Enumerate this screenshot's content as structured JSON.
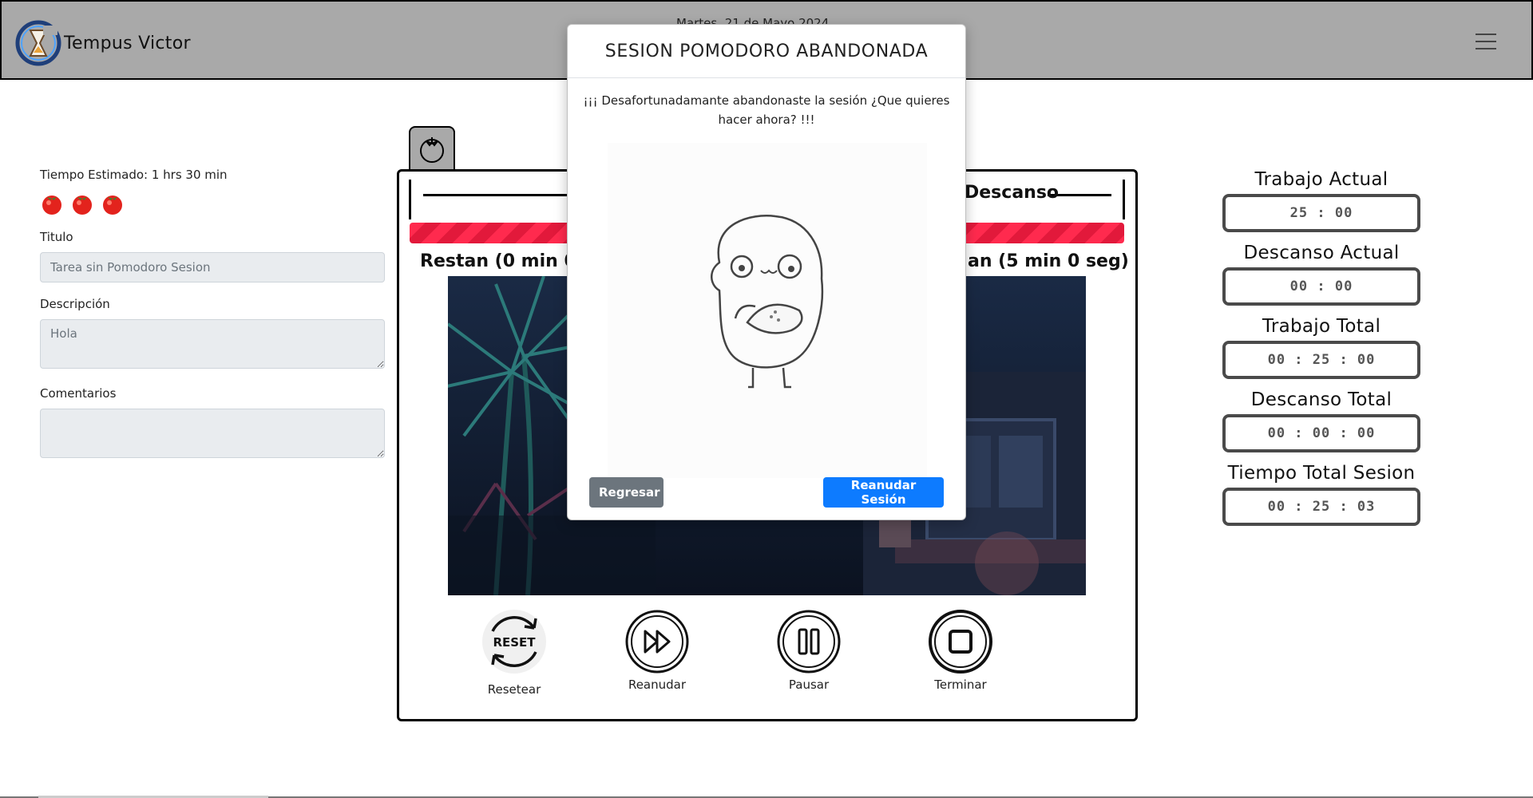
{
  "navbar": {
    "brand": "Tempus Victor",
    "date": "Martes, 21 de Mayo 2024"
  },
  "left": {
    "estimated": "Tiempo Estimado: 1 hrs 30 min",
    "tomato_count": 3,
    "title_label": "Titulo",
    "title_value": "Tarea sin Pomodoro Sesion",
    "description_label": "Descripción",
    "description_value": "Hola",
    "comments_label": "Comentarios",
    "comments_value": ""
  },
  "timer": {
    "phase_right": "Descanso",
    "remaining_left": "Restan (0 min 0",
    "remaining_right": "an (5 min 0 seg)",
    "progress_percent": 100,
    "controls": [
      "Resetear",
      "Reanudar",
      "Pausar",
      "Terminar"
    ],
    "reset_text": "RESET"
  },
  "stats": [
    {
      "label": "Trabajo Actual",
      "value": "25 : 00"
    },
    {
      "label": "Descanso Actual",
      "value": "00 : 00"
    },
    {
      "label": "Trabajo Total",
      "value": "00 : 25 : 00"
    },
    {
      "label": "Descanso Total",
      "value": "00 : 00 : 00"
    },
    {
      "label": "Tiempo Total Sesion",
      "value": "00 : 25 : 03"
    }
  ],
  "modal": {
    "title": "SESION POMODORO ABANDONADA",
    "message": "¡¡¡ Desafortunadamante abandonaste la sesión ¿Que quieres hacer ahora? !!!",
    "back_button": "Regresar",
    "resume_button": "Reanudar Sesión"
  },
  "colors": {
    "navbar": "#a9a9a9",
    "progress": "#ff2a4e",
    "primary": "#0d7bff",
    "secondary": "#6c757d"
  }
}
